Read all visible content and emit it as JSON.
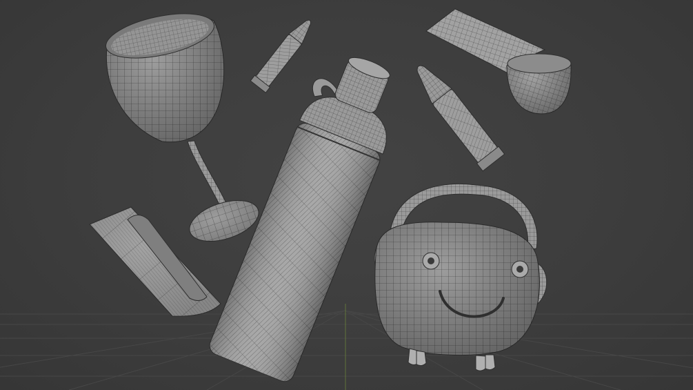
{
  "viewport": {
    "background": "#3d3d3d",
    "mesh_fill": "#9b9b9b",
    "wire_color": "#2f2f2f",
    "grid_color": "#474747",
    "y_axis_color": "#6f8a3a"
  },
  "objects": [
    {
      "name": "wine-glass",
      "type": "glass mesh"
    },
    {
      "name": "bullet-small",
      "type": "bullet mesh"
    },
    {
      "name": "water-bottle",
      "type": "bottle mesh"
    },
    {
      "name": "measuring-scoop",
      "type": "scoop mesh"
    },
    {
      "name": "bullet-large",
      "type": "bullet mesh"
    },
    {
      "name": "curled-sheet",
      "type": "sheet mesh"
    },
    {
      "name": "radio-character",
      "type": "character mesh"
    }
  ]
}
